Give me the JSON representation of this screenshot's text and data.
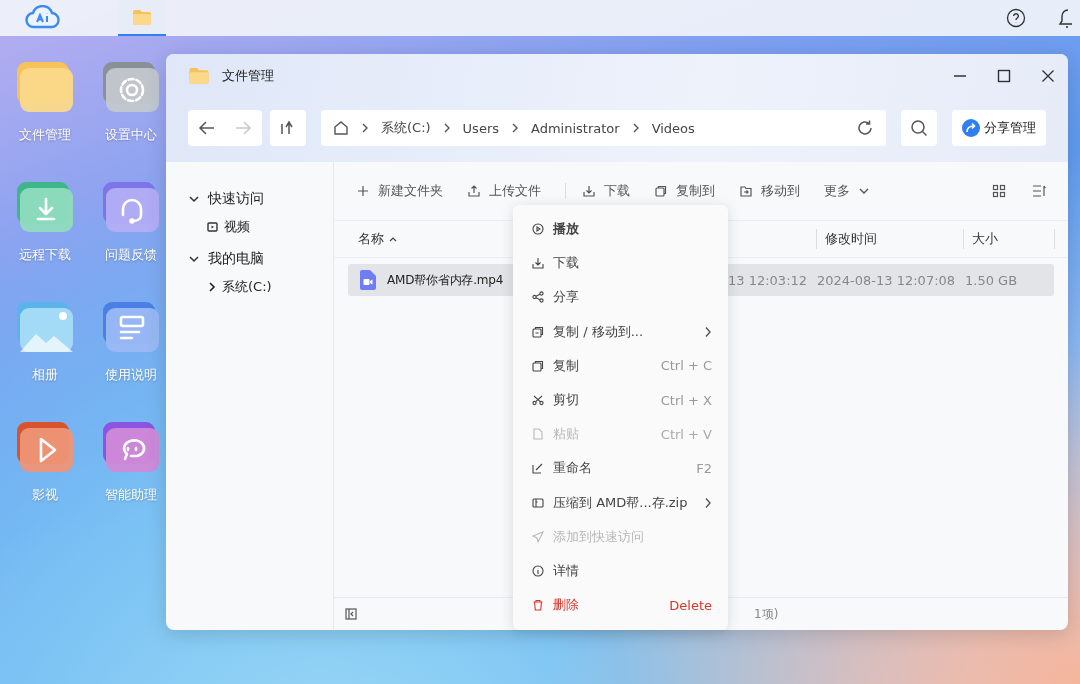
{
  "taskbar": {
    "tabs": [
      {
        "kind": "folder",
        "selected": true
      }
    ]
  },
  "desktop_icons": [
    {
      "label": "文件管理",
      "kind": "folder"
    },
    {
      "label": "设置中心",
      "kind": "settings"
    },
    {
      "label": "远程下载",
      "kind": "download"
    },
    {
      "label": "问题反馈",
      "kind": "support"
    },
    {
      "label": "相册",
      "kind": "photos"
    },
    {
      "label": "使用说明",
      "kind": "guide"
    },
    {
      "label": "影视",
      "kind": "video"
    },
    {
      "label": "智能助理",
      "kind": "assistant"
    }
  ],
  "window": {
    "title": "文件管理"
  },
  "nav": {
    "back_disabled": false,
    "forward_disabled": true
  },
  "breadcrumb": [
    "系统(C:)",
    "Users",
    "Administrator",
    "Videos"
  ],
  "share_button": "分享管理",
  "sidebar": [
    {
      "label": "快速访问",
      "expanded": true,
      "children": [
        {
          "label": "视频",
          "kind": "video"
        }
      ]
    },
    {
      "label": "我的电脑",
      "expanded": true,
      "children": [
        {
          "label": "系统(C:)",
          "kind": "drive",
          "expanded": false
        }
      ]
    }
  ],
  "actions": [
    {
      "label": "新建文件夹",
      "kind": "new"
    },
    {
      "label": "上传文件",
      "kind": "upload"
    },
    {
      "label": "下载",
      "kind": "download"
    },
    {
      "label": "复制到",
      "kind": "copy"
    },
    {
      "label": "移动到",
      "kind": "move"
    },
    {
      "label": "更多",
      "kind": "more"
    }
  ],
  "table": {
    "columns": [
      {
        "label": "名称",
        "sorted_ascending": true
      },
      {
        "label": "修改时间"
      },
      {
        "label": "大小"
      }
    ],
    "rows": [
      {
        "name": "AMD帮你省内存.mp4",
        "column_2": "13 12:03:12",
        "modified": "2024-08-13 12:07:08",
        "size": "1.50 GB",
        "selected": true
      }
    ]
  },
  "status": "1项)",
  "context_menu": [
    {
      "label": "播放",
      "kind": "play",
      "default": true,
      "disabled": false,
      "danger": false,
      "submenu": false
    },
    {
      "label": "下载",
      "kind": "download",
      "default": false,
      "disabled": false,
      "danger": false,
      "submenu": false
    },
    {
      "label": "分享",
      "kind": "share",
      "default": false,
      "disabled": false,
      "danger": false,
      "submenu": false
    },
    {
      "label": "复制 / 移动到...",
      "kind": "copymove",
      "default": false,
      "disabled": false,
      "danger": false,
      "submenu": true
    },
    {
      "label": "复制",
      "kind": "copy",
      "shortcut": "Ctrl + C",
      "default": false,
      "disabled": false,
      "danger": false,
      "submenu": false
    },
    {
      "label": "剪切",
      "kind": "cut",
      "shortcut": "Ctrl + X",
      "default": false,
      "disabled": false,
      "danger": false,
      "submenu": false
    },
    {
      "label": "粘贴",
      "kind": "paste",
      "shortcut": "Ctrl + V",
      "default": false,
      "disabled": true,
      "danger": false,
      "submenu": false
    },
    {
      "label": "重命名",
      "kind": "rename",
      "shortcut": "F2",
      "default": false,
      "disabled": false,
      "danger": false,
      "submenu": false
    },
    {
      "label": "压缩到 AMD帮...存.zip",
      "kind": "zip",
      "default": false,
      "disabled": false,
      "danger": false,
      "submenu": true
    },
    {
      "label": "添加到快速访问",
      "kind": "pin",
      "default": false,
      "disabled": true,
      "danger": false,
      "submenu": false
    },
    {
      "label": "详情",
      "kind": "info",
      "default": false,
      "disabled": false,
      "danger": false,
      "submenu": false
    },
    {
      "label": "删除",
      "kind": "delete",
      "shortcut": "Delete",
      "default": false,
      "disabled": false,
      "danger": true,
      "submenu": false
    }
  ]
}
